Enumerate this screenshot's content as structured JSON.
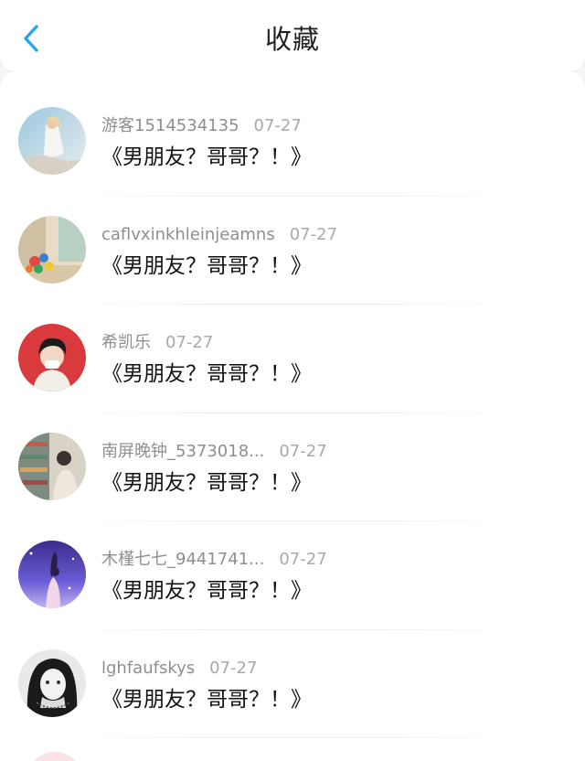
{
  "header": {
    "title": "收藏",
    "back_icon": "chevron-left-icon",
    "accent_color": "#2aa4ec"
  },
  "favorites": [
    {
      "username": "游客1514534135",
      "date": "07-27",
      "title": "《男朋友？哥哥？！》",
      "avatar": "avatar-photo-white-dress"
    },
    {
      "username": "caflvxinkhleinjeamns",
      "date": "07-27",
      "title": "《男朋友？哥哥？！》",
      "avatar": "avatar-photo-balloons"
    },
    {
      "username": "希凯乐",
      "date": "07-27",
      "title": "《男朋友？哥哥？！》",
      "avatar": "avatar-photo-red-background"
    },
    {
      "username": "南屏晚钟_5373018...",
      "date": "07-27",
      "title": "《男朋友？哥哥？！》",
      "avatar": "avatar-photo-store"
    },
    {
      "username": "木槿七七_9441741...",
      "date": "07-27",
      "title": "《男朋友？哥哥？！》",
      "avatar": "avatar-photo-purple-night"
    },
    {
      "username": "lghfaufskys",
      "date": "07-27",
      "title": "《男朋友？哥哥？！》",
      "avatar": "avatar-photo-black-white"
    }
  ]
}
